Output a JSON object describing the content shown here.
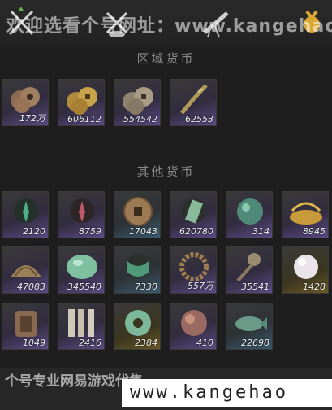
{
  "watermark_top": "欢迎选看个号网址：www.kangehao",
  "watermark_bottom_cn": "个号专业网易游戏代售",
  "watermark_bottom_url": "www.kangehao",
  "sections": [
    {
      "title": "区域货币"
    },
    {
      "title": "其他货币"
    }
  ],
  "region_items": [
    {
      "icon": "coins-bronze-icon",
      "count": "172万"
    },
    {
      "icon": "coins-gold-icon",
      "count": "606112"
    },
    {
      "icon": "coins-silver-icon",
      "count": "554542"
    },
    {
      "icon": "feather-token-icon",
      "count": "62553"
    }
  ],
  "other_items": [
    {
      "icon": "jade-pendant-green-icon",
      "count": "2120"
    },
    {
      "icon": "jade-pendant-red-icon",
      "count": "8759"
    },
    {
      "icon": "ancient-coin-icon",
      "count": "17043"
    },
    {
      "icon": "jade-tablet-icon",
      "count": "620780"
    },
    {
      "icon": "jade-orb-icon",
      "count": "314"
    },
    {
      "icon": "gold-pile-icon",
      "count": "8945"
    },
    {
      "icon": "bronze-shell-icon",
      "count": "47083"
    },
    {
      "icon": "jade-stone-icon",
      "count": "345540"
    },
    {
      "icon": "jade-fabric-icon",
      "count": "7330"
    },
    {
      "icon": "bead-bracelet-icon",
      "count": "557万"
    },
    {
      "icon": "coin-sword-icon",
      "count": "35541"
    },
    {
      "icon": "pearl-icon",
      "count": "1428"
    },
    {
      "icon": "bronze-plaque-icon",
      "count": "1049"
    },
    {
      "icon": "bamboo-slips-icon",
      "count": "2416"
    },
    {
      "icon": "jade-ring-icon",
      "count": "2384"
    },
    {
      "icon": "red-orb-icon",
      "count": "410"
    },
    {
      "icon": "jade-fish-icon",
      "count": "22698"
    }
  ],
  "colors": {
    "background": "#1e1e1e",
    "title": "#8a8a8a",
    "count": "#f0f0f0"
  }
}
